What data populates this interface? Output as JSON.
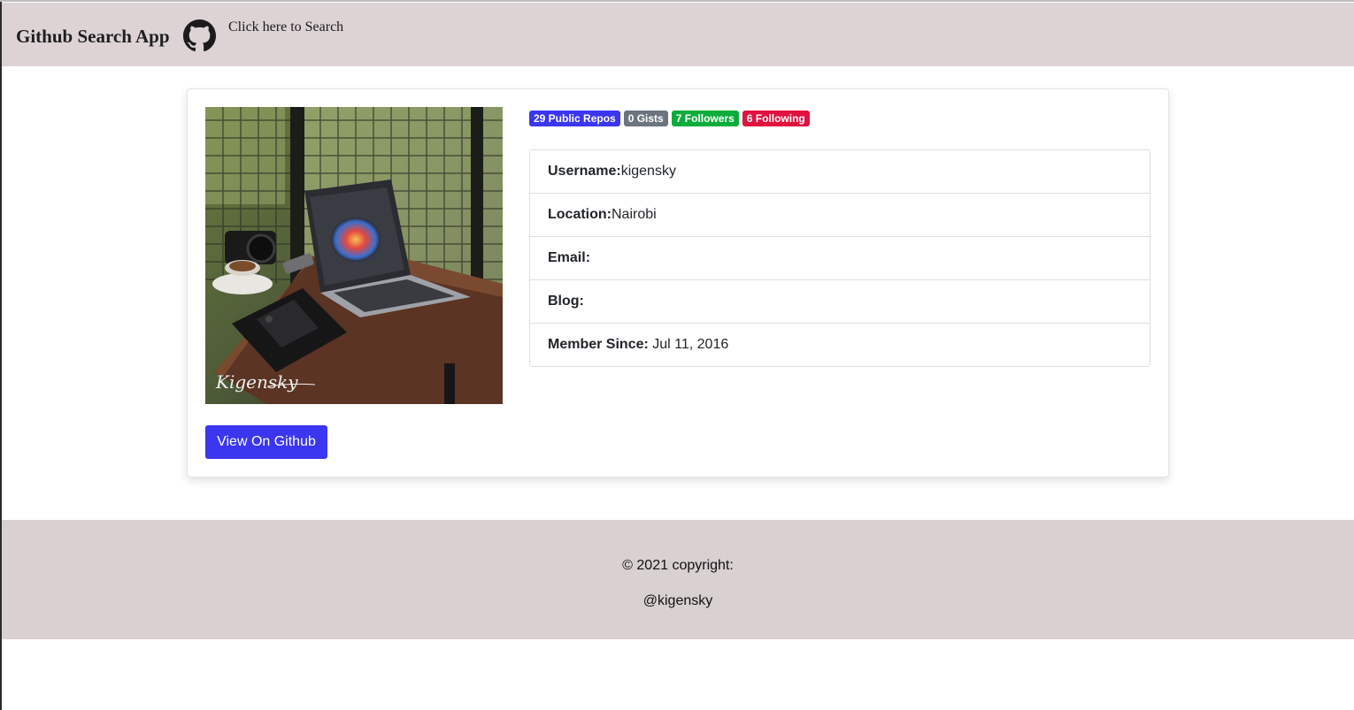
{
  "navbar": {
    "brand": "Github Search App",
    "search_link": "Click here to Search",
    "icon": "github-icon"
  },
  "badges": [
    {
      "label": "29 Public Repos",
      "color": "#3b36f0"
    },
    {
      "label": "0 Gists",
      "color": "#6c757d"
    },
    {
      "label": "7 Followers",
      "color": "#0aad3c"
    },
    {
      "label": "6 Following",
      "color": "#e0123f"
    }
  ],
  "profile": {
    "username_label": "Username:",
    "username": "kigensky",
    "location_label": "Location:",
    "location": "Nairobi",
    "email_label": "Email:",
    "email": "",
    "blog_label": "Blog:",
    "blog": "",
    "member_since_label": "Member Since:",
    "member_since": " Jul 11, 2016",
    "avatar_signature": "Kigensky"
  },
  "button": {
    "label": "View On Github",
    "color": "#3b36f0"
  },
  "footer": {
    "copyright": "© 2021 copyright:",
    "handle": "@kigensky"
  }
}
